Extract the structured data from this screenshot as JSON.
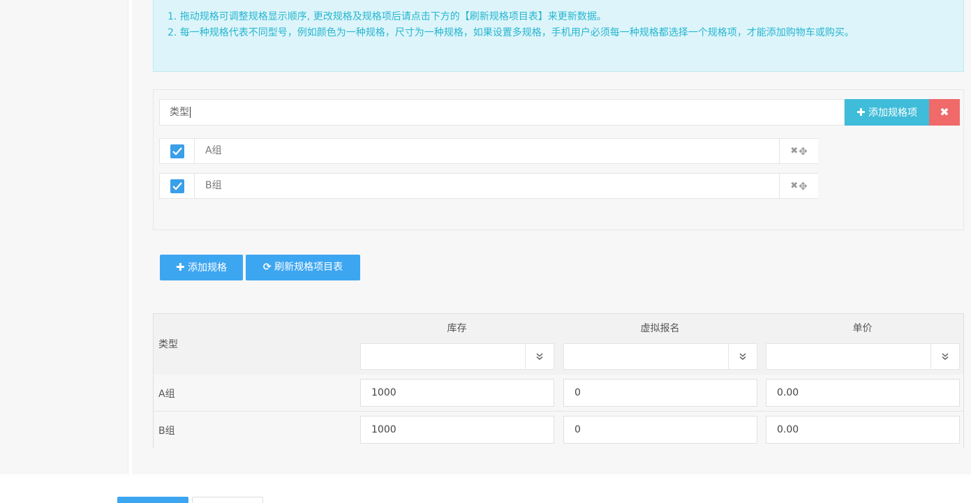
{
  "tips": {
    "line1": "1. 拖动规格可调整规格显示顺序, 更改规格及规格项后请点击下方的【刷新规格项目表】来更新数据。",
    "line2": "2. 每一种规格代表不同型号，例如颜色为一种规格，尺寸为一种规格，如果设置多规格，手机用户必须每一种规格都选择一个规格项，才能添加购物车或购买。"
  },
  "spec": {
    "name_value": "类型",
    "add_item_label": "添加规格项",
    "items": [
      {
        "title": "A组",
        "checked": true
      },
      {
        "title": "B组",
        "checked": true
      }
    ]
  },
  "actions": {
    "add_spec_label": "添加规格",
    "refresh_label": "刷新规格项目表"
  },
  "sku_table": {
    "type_header": "类型",
    "columns": [
      "库存",
      "虚拟报名",
      "单价"
    ],
    "rows": [
      {
        "label": "A组",
        "values": [
          "1000",
          "0",
          "0.00"
        ]
      },
      {
        "label": "B组",
        "values": [
          "1000",
          "0",
          "0.00"
        ]
      }
    ]
  },
  "colors": {
    "tip_text": "#27b5d0",
    "primary": "#3da6f1",
    "info": "#3fbcd9",
    "danger": "#ef6a69"
  }
}
